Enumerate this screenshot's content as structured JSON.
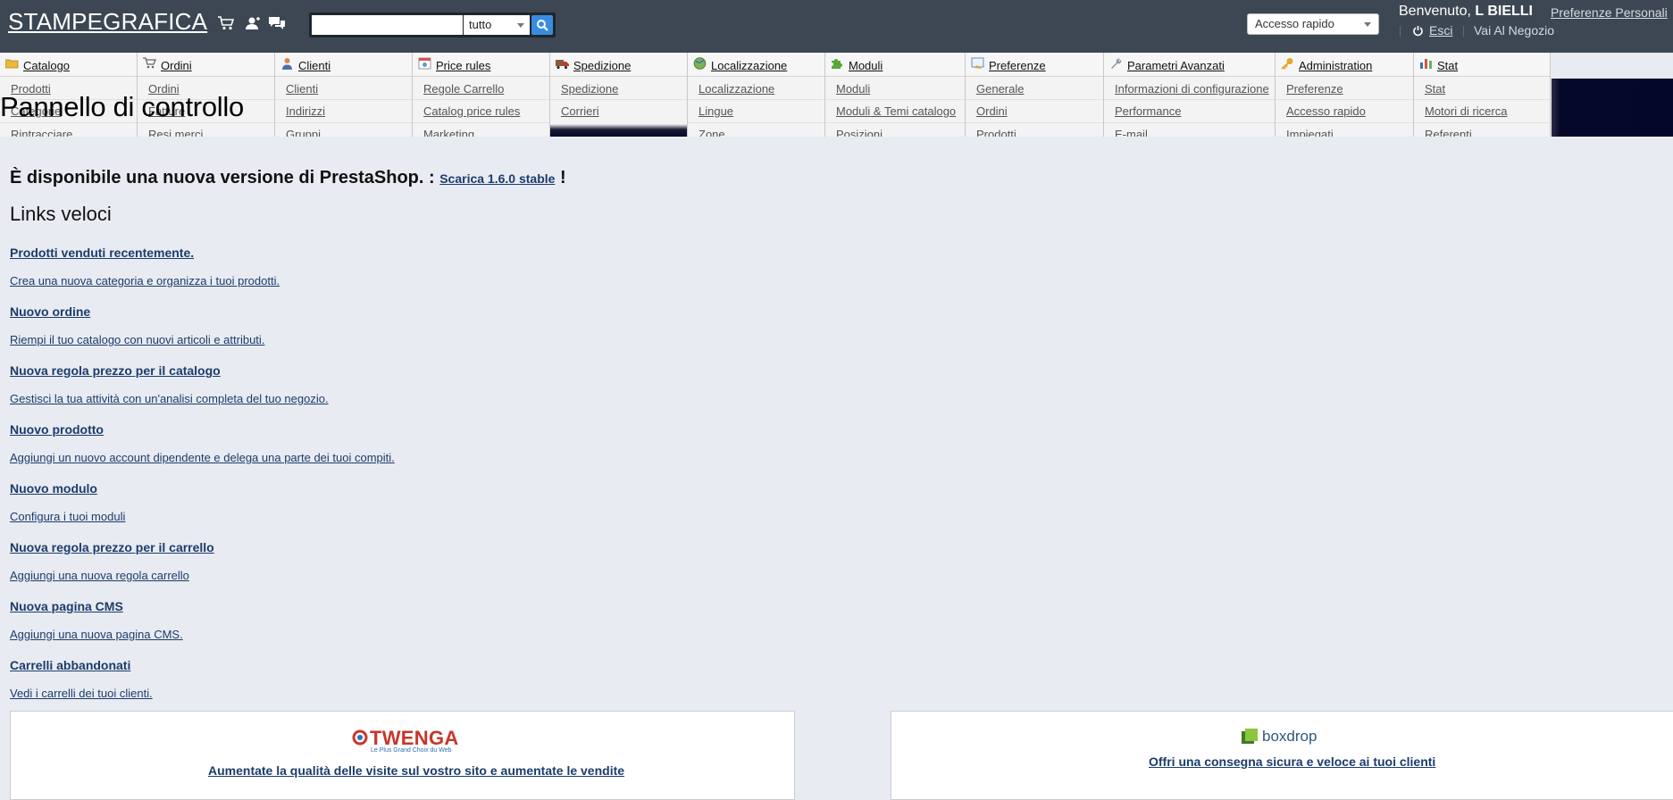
{
  "header": {
    "shop_name": "STAMPEGRAFICA",
    "search": {
      "value": "",
      "scope": "tutto"
    },
    "quick_access": "Accesso rapido",
    "welcome_prefix": "Benvenuto,",
    "employee_name": "L BIELLI",
    "personal_prefs": "Preferenze Personali",
    "logout": "Esci",
    "view_shop": "Vai Al Negozio"
  },
  "tabs": [
    {
      "label": "Catalogo",
      "items": [
        "Prodotti",
        "Categorie",
        "Rintracciare"
      ]
    },
    {
      "label": "Ordini",
      "items": [
        "Ordini",
        "Fatture",
        "Resi merci"
      ]
    },
    {
      "label": "Clienti",
      "items": [
        "Clienti",
        "Indirizzi",
        "Gruppi"
      ]
    },
    {
      "label": "Price rules",
      "items": [
        "Regole Carrello",
        "Catalog price rules",
        "Marketing"
      ]
    },
    {
      "label": "Spedizione",
      "items": [
        "Spedizione",
        "Corrieri"
      ]
    },
    {
      "label": "Localizzazione",
      "items": [
        "Localizzazione",
        "Lingue",
        "Zone"
      ]
    },
    {
      "label": "Moduli",
      "items": [
        "Moduli",
        "Moduli & Temi catalogo",
        "Posizioni"
      ]
    },
    {
      "label": "Preferenze",
      "items": [
        "Generale",
        "Ordini",
        "Prodotti"
      ]
    },
    {
      "label": "Parametri Avanzati",
      "items": [
        "Informazioni di configurazione",
        "Performance",
        "E-mail"
      ]
    },
    {
      "label": "Administration",
      "items": [
        "Preferenze",
        "Accesso rapido",
        "Impiegati"
      ]
    },
    {
      "label": "Stat",
      "items": [
        "Stat",
        "Motori di ricerca",
        "Referenti"
      ]
    }
  ],
  "page_title": "Pannello di controllo",
  "update_notice": {
    "text": "È disponibile una nuova versione di PrestaShop. :",
    "link": "Scarica 1.6.0 stable",
    "suffix": "!"
  },
  "quick_links": {
    "title": "Links veloci",
    "items": [
      {
        "title": "Prodotti venduti recentemente.",
        "desc": "Crea una nuova categoria e organizza i tuoi prodotti."
      },
      {
        "title": "Nuovo ordine",
        "desc": "Riempi il tuo catalogo con nuovi articoli e attributi."
      },
      {
        "title": "Nuova regola prezzo per il catalogo",
        "desc": "Gestisci la tua attività con un'analisi completa del tuo negozio."
      },
      {
        "title": "Nuovo prodotto",
        "desc": "Aggiungi un nuovo account dipendente e delega una parte dei tuoi compiti."
      },
      {
        "title": "Nuovo modulo",
        "desc": "Configura i tuoi moduli"
      },
      {
        "title": "Nuova regola prezzo per il carrello",
        "desc": "Aggiungi una nuova regola carrello"
      },
      {
        "title": "Nuova pagina CMS",
        "desc": "Aggiungi una nuova pagina CMS."
      },
      {
        "title": "Carrelli abbandonati",
        "desc": "Vedi i carrelli dei tuoi clienti."
      }
    ]
  },
  "partners": {
    "twenga": {
      "logo_text": "TWENGA",
      "tagline": "Le Plus Grand Choix du Web",
      "link": "Aumentate la qualità delle visite sul vostro sito e aumentate le vendite"
    },
    "boxdrop": {
      "logo_text": "boxdrop",
      "link": "Offri una consegna sicura e veloce ai tuoi clienti"
    }
  },
  "colors": {
    "header_bg": "#3c4753",
    "page_bg": "#e9ebf2",
    "link": "#1b3c6b",
    "search_button": "#3a8ce0",
    "twenga_red": "#c8362a"
  }
}
